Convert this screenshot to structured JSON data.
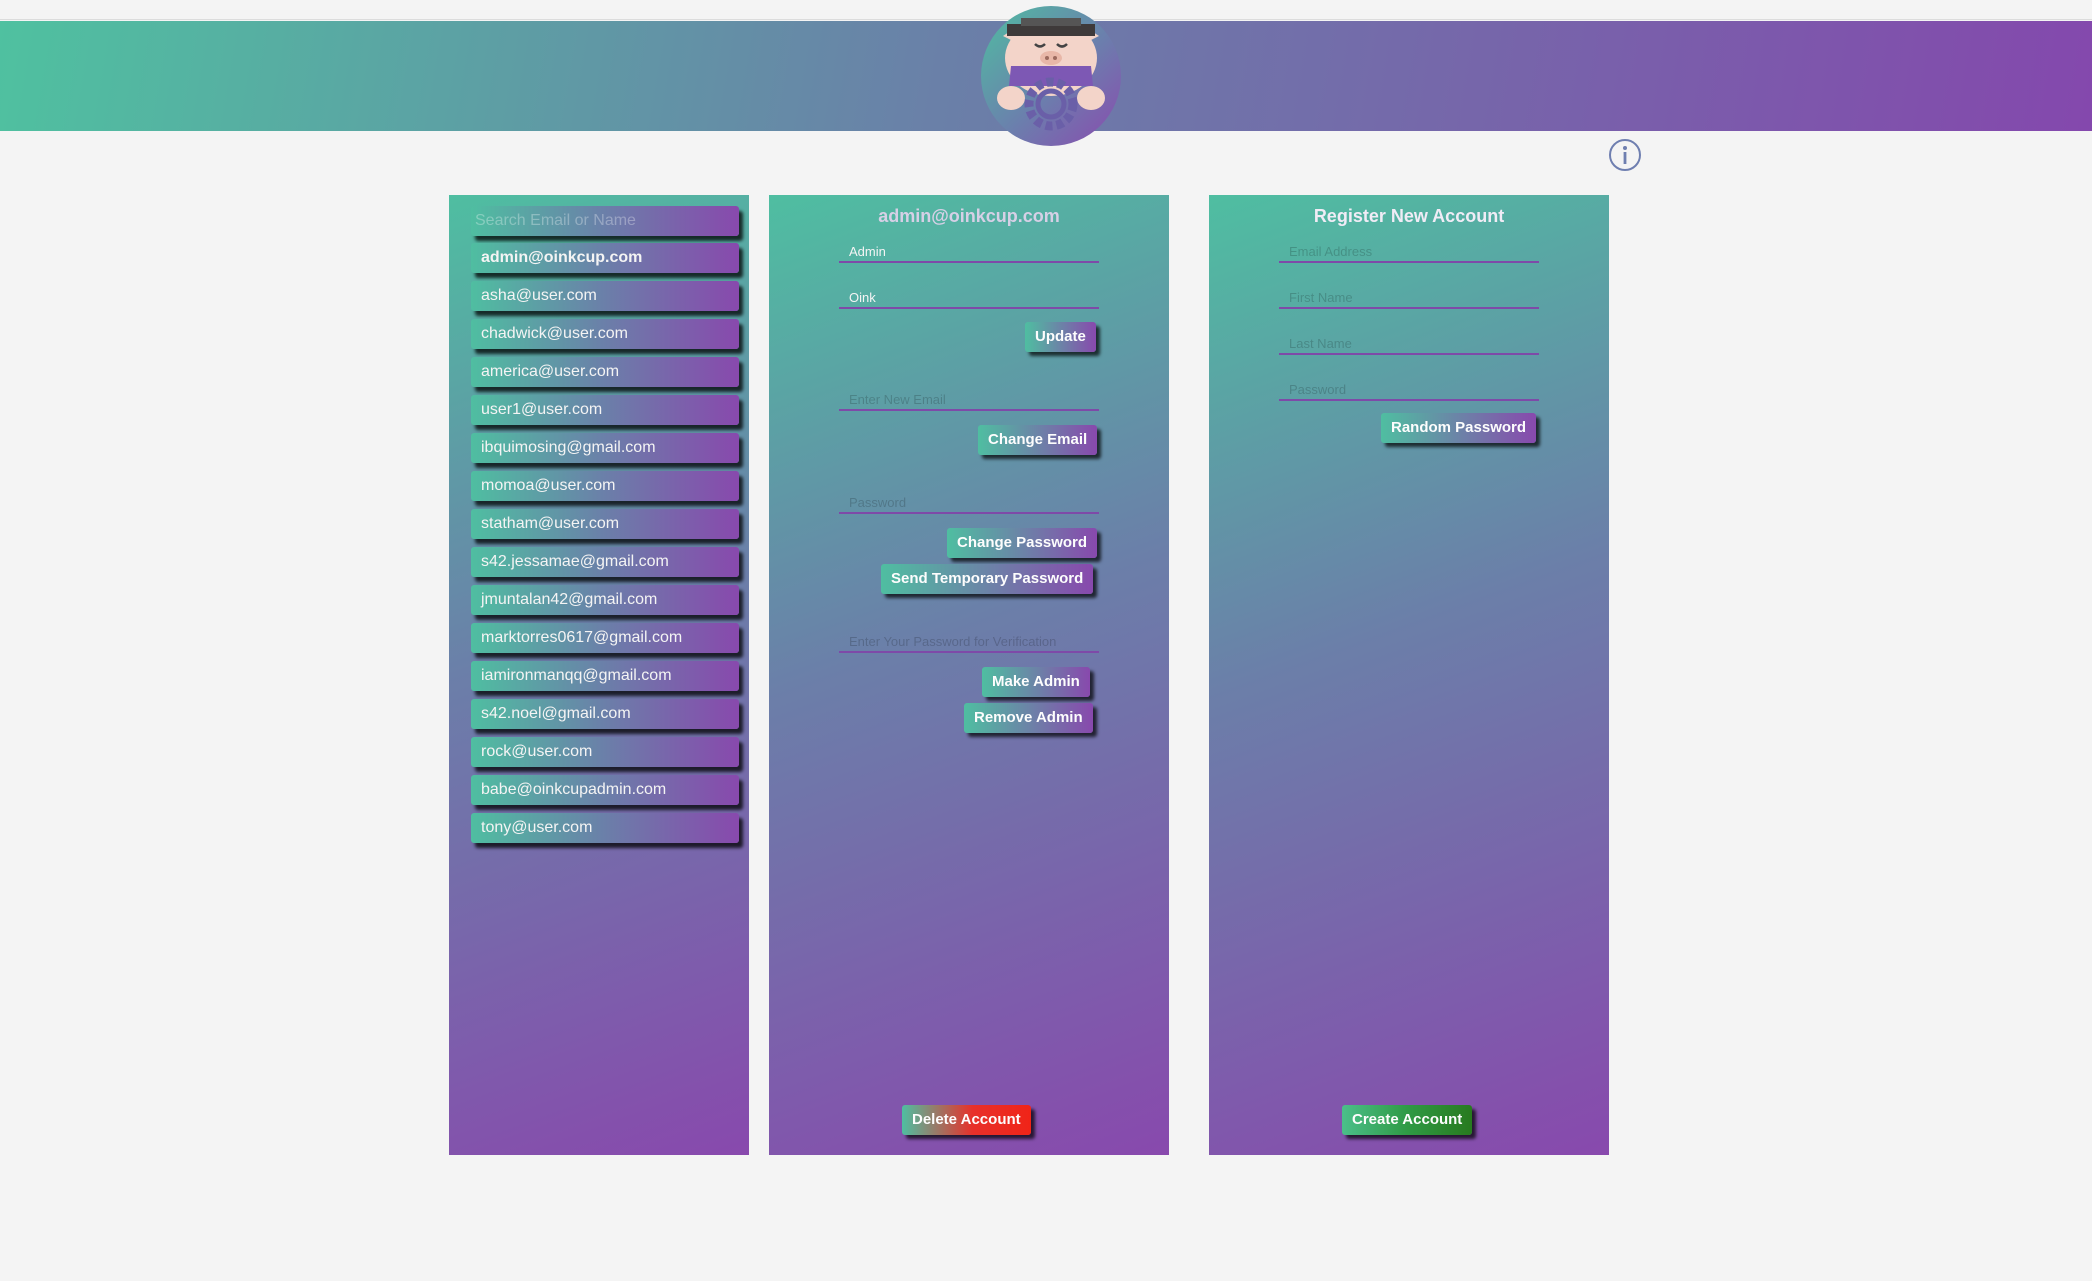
{
  "header": {
    "logo_label": "OinkCup admin logo",
    "info_icon": "info-circle-icon"
  },
  "users": {
    "search_placeholder": "Search Email or Name",
    "items": [
      "admin@oinkcup.com",
      "asha@user.com",
      "chadwick@user.com",
      "america@user.com",
      "user1@user.com",
      "ibquimosing@gmail.com",
      "momoa@user.com",
      "statham@user.com",
      "s42.jessamae@gmail.com",
      "jmuntalan42@gmail.com",
      "marktorres0617@gmail.com",
      "iamironmanqq@gmail.com",
      "s42.noel@gmail.com",
      "rock@user.com",
      "babe@oinkcupadmin.com",
      "tony@user.com"
    ],
    "selected": "admin@oinkcup.com"
  },
  "account": {
    "email": "admin@oinkcup.com",
    "first_name": "Admin",
    "last_name": "Oink",
    "update_label": "Update",
    "new_email_placeholder": "Enter New Email",
    "change_email_label": "Change Email",
    "password_placeholder": "Password",
    "change_password_label": "Change Password",
    "send_temp_password_label": "Send Temporary Password",
    "verify_password_placeholder": "Enter Your Password for Verification",
    "make_admin_label": "Make Admin",
    "remove_admin_label": "Remove Admin",
    "delete_label": "Delete Account"
  },
  "register": {
    "title": "Register New Account",
    "email_placeholder": "Email Address",
    "first_name_placeholder": "First Name",
    "last_name_placeholder": "Last Name",
    "password_placeholder": "Password",
    "random_password_label": "Random Password",
    "create_label": "Create Account"
  },
  "colors": {
    "gradient_start": "#4fbea1",
    "gradient_end": "#8849ad",
    "page_background": "#f4f4f4",
    "delete_accent": "#f02418",
    "create_accent": "#287a1f"
  }
}
